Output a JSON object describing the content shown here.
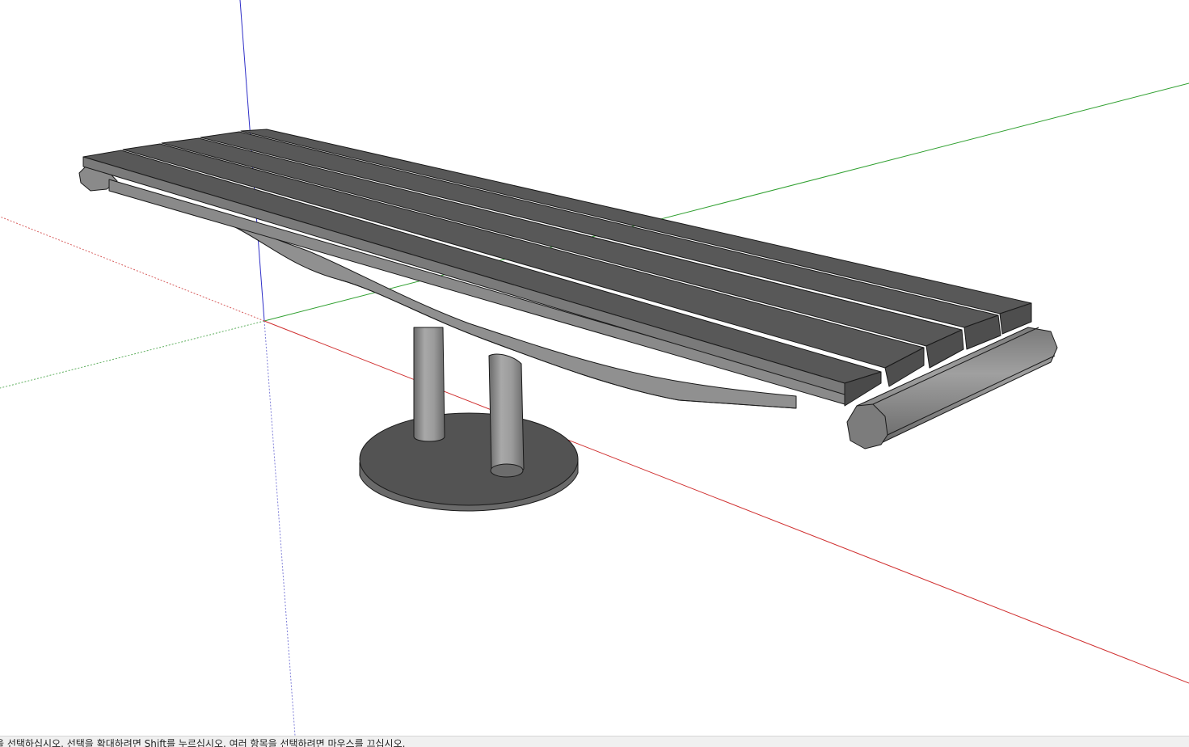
{
  "status_bar": {
    "hint_text": "을 선택하십시오. 선택을 확대하려면 Shift를 누르십시오. 여러 항목을 선택하려면 마우스를 끄십시오."
  },
  "viewport": {
    "model": "bench-model",
    "axis_colors": {
      "x_axis": "#d42a2a",
      "y_axis": "#2aa02a",
      "z_axis": "#2a2ad4"
    },
    "colors": {
      "background": "#ffffff",
      "slat_top": "#5a5a5a",
      "slat_side": "#707070",
      "metal_light": "#9a9a9a",
      "metal_dark": "#6e6e6e",
      "edge": "#1a1a1a"
    }
  }
}
